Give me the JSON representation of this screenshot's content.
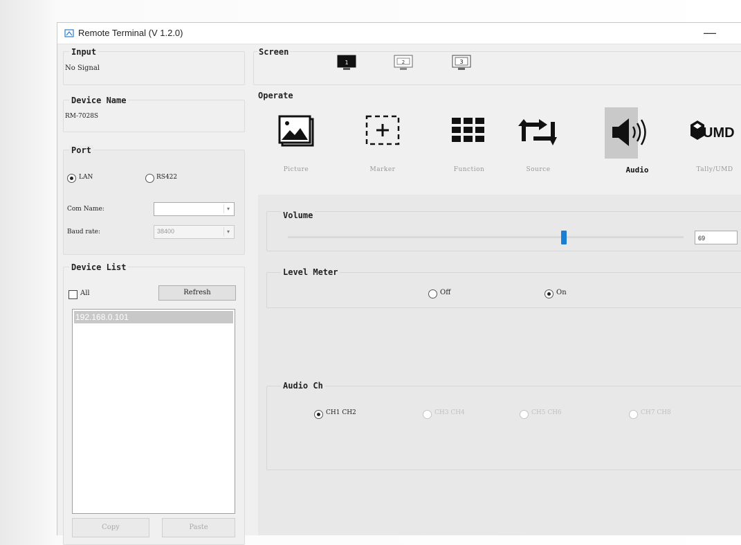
{
  "window": {
    "title": "Remote Terminal (V 1.2.0)",
    "minimize_glyph": "—"
  },
  "input": {
    "title": "Input",
    "value": "No Signal"
  },
  "device_name": {
    "title": "Device Name",
    "value": "RM-7028S"
  },
  "port": {
    "title": "Port",
    "options": [
      "LAN",
      "RS422"
    ],
    "selected": "LAN",
    "com_name_label": "Com Name:",
    "com_name_value": "",
    "baud_rate_label": "Baud rate:",
    "baud_rate_value": "38400"
  },
  "device_list": {
    "title": "Device List",
    "all_label": "All",
    "refresh_label": "Refresh",
    "items": [
      "192.168.0.101"
    ],
    "copy_label": "Copy",
    "paste_label": "Paste"
  },
  "screen": {
    "title": "Screen",
    "buttons": [
      "1",
      "2",
      "3"
    ],
    "active": "1"
  },
  "operate": {
    "title": "Operate",
    "items": [
      {
        "label": "Picture",
        "icon": "picture-icon"
      },
      {
        "label": "Marker",
        "icon": "marker-icon"
      },
      {
        "label": "Function",
        "icon": "function-grid-icon"
      },
      {
        "label": "Source",
        "icon": "source-swap-icon"
      },
      {
        "label": "Audio",
        "icon": "speaker-icon"
      },
      {
        "label": "Tally/UMD",
        "icon": "umd-icon"
      }
    ],
    "active": "Audio",
    "umd_logo_text": "UMD"
  },
  "audio": {
    "volume_label": "Volume",
    "volume_value": "69",
    "volume_fraction": 0.69,
    "level_meter_label": "Level Meter",
    "level_meter_options": [
      "Off",
      "On"
    ],
    "level_meter_selected": "On",
    "audio_ch_label": "Audio Ch",
    "audio_ch_options": [
      "CH1 CH2",
      "CH3 CH4",
      "CH5 CH6",
      "CH7 CH8"
    ],
    "audio_ch_selected": "CH1 CH2"
  },
  "colors": {
    "accent": "#1a7fd4",
    "active_tile": "#c9c9c9",
    "list_selection": "#c8c8c8"
  }
}
